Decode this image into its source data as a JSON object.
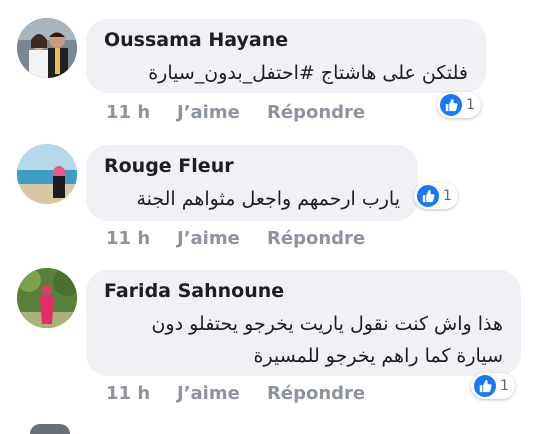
{
  "comments": [
    {
      "author": "Oussama Hayane",
      "text_lines": [
        "فلتكن على هاشتاج #احتفل_بدون_سيارة"
      ],
      "time": "11 h",
      "like_label": "J’aime",
      "reply_label": "Répondre",
      "reaction_count": "1",
      "avatar_icon": "couple-photo-avatar"
    },
    {
      "author": "Rouge Fleur",
      "text_lines": [
        "يارب ارحمهم واجعل مثواهم الجنة"
      ],
      "time": "11 h",
      "like_label": "J’aime",
      "reply_label": "Répondre",
      "reaction_count": "1",
      "avatar_icon": "beach-photo-avatar"
    },
    {
      "author": "Farida Sahnoune",
      "text_lines": [
        "هذا واش كنت نقول ياريت يخرجو يحتفلو دون",
        "سيارة كما راهم يخرجو للمسيرة"
      ],
      "time": "11 h",
      "like_label": "J’aime",
      "reply_label": "Répondre",
      "reaction_count": "1",
      "avatar_icon": "garden-photo-avatar"
    }
  ],
  "colors": {
    "bubble_bg": "#eff1f4",
    "meta_text": "#8d949e",
    "like_blue": "#1a78f4"
  }
}
